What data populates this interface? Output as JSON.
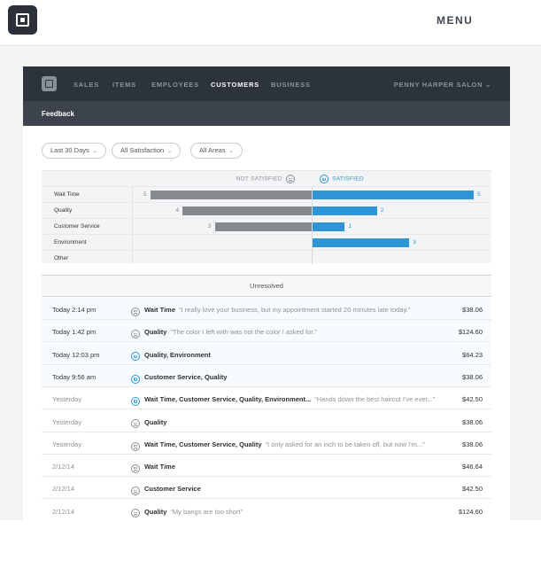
{
  "header": {
    "menu_label": "MENU"
  },
  "app_nav": {
    "items": [
      "SALES",
      "ITEMS",
      "EMPLOYEES",
      "CUSTOMERS",
      "BUSINESS"
    ],
    "active": "CUSTOMERS",
    "account": "PENNY HARPER SALON"
  },
  "subnav": {
    "title": "Feedback"
  },
  "filters": [
    "Last 30 Days",
    "All Satisfaction",
    "All Areas"
  ],
  "chart_data": {
    "type": "bar",
    "header_negative": "NOT SATISFIED",
    "header_positive": "SATISFIED",
    "categories": [
      "Wait Time",
      "Quality",
      "Customer Service",
      "Environment",
      "Other"
    ],
    "series": [
      {
        "name": "NOT SATISFIED",
        "values": [
          5,
          4,
          3,
          0,
          0
        ]
      },
      {
        "name": "SATISFIED",
        "values": [
          5,
          2,
          1,
          3,
          0
        ]
      }
    ],
    "colors": {
      "negative": "#86898d",
      "positive": "#2f95d6"
    }
  },
  "feedback": {
    "section_title": "Unresolved",
    "rows": [
      {
        "date": "Today  2:14 pm",
        "mood": "sad",
        "topics": "Wait Time",
        "quote": "“I really love your business, but my appointment started 20 minutes late today.”",
        "amount": "$38.06",
        "today": true
      },
      {
        "date": "Today  1:42 pm",
        "mood": "sad",
        "topics": "Quality",
        "quote": "“The color I left with was not the color I asked for.”",
        "amount": "$124.60",
        "today": true
      },
      {
        "date": "Today  12:03 pm",
        "mood": "happy",
        "topics": "Quality, Environment",
        "quote": "",
        "amount": "$64.23",
        "today": true
      },
      {
        "date": "Today  9:56 am",
        "mood": "happy",
        "topics": "Customer Service, Quality",
        "quote": "",
        "amount": "$38.06",
        "today": true
      },
      {
        "date": "Yesterday",
        "mood": "happy",
        "topics": "Wait Time, Customer Service, Quality, Environment...",
        "quote": "“Hands down the best haircut I've ever...”",
        "amount": "$42.50",
        "today": false
      },
      {
        "date": "Yesterday",
        "mood": "sad",
        "topics": "Quality",
        "quote": "",
        "amount": "$38.06",
        "today": false
      },
      {
        "date": "Yesterday",
        "mood": "sad",
        "topics": "Wait Time, Customer Service, Quality",
        "quote": "“I only asked for an inch to be taken off, but now I'm...”",
        "amount": "$38.06",
        "today": false
      },
      {
        "date": "2/12/14",
        "mood": "sad",
        "topics": "Wait Time",
        "quote": "",
        "amount": "$46.64",
        "today": false
      },
      {
        "date": "2/12/14",
        "mood": "sad",
        "topics": "Customer Service",
        "quote": "",
        "amount": "$42.50",
        "today": false
      },
      {
        "date": "2/12/14",
        "mood": "sad",
        "topics": "Quality",
        "quote": "“My bangs are too short”",
        "amount": "$124.60",
        "today": false
      }
    ]
  }
}
